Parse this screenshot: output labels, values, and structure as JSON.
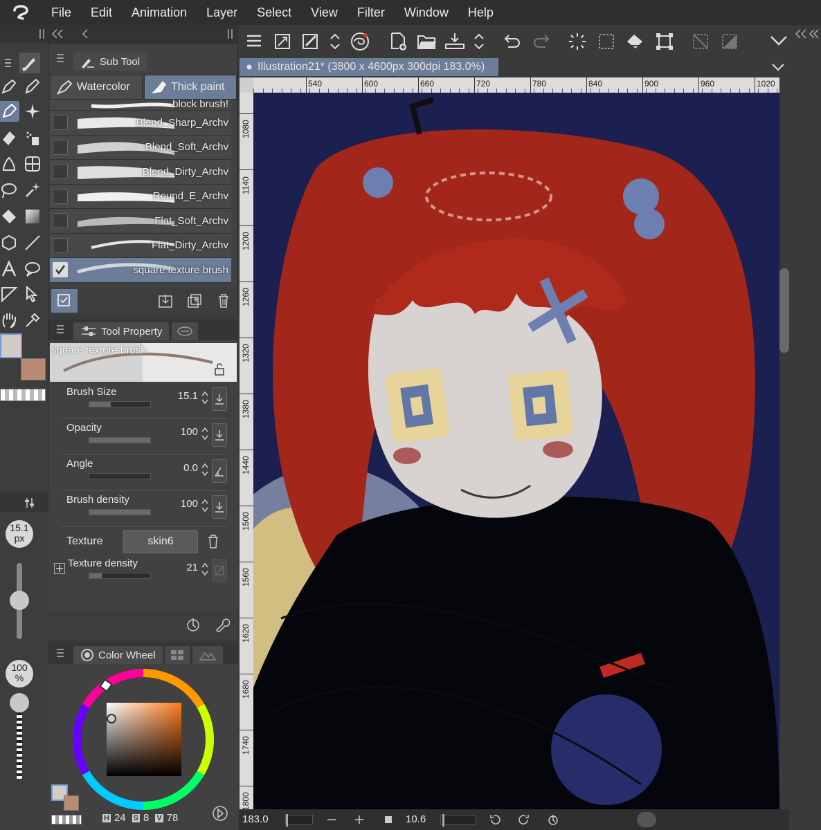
{
  "menu": {
    "items": [
      "File",
      "Edit",
      "Animation",
      "Layer",
      "Select",
      "View",
      "Filter",
      "Window",
      "Help"
    ]
  },
  "subtool": {
    "panel_title": "Sub Tool",
    "groups": [
      {
        "label": "Watercolor",
        "active": false
      },
      {
        "label": "Thick paint",
        "active": true
      }
    ],
    "brushes": [
      {
        "name": "block brush!",
        "active": false
      },
      {
        "name": "Blend_Sharp_Archv",
        "active": false
      },
      {
        "name": "Blend_Soft_Archv",
        "active": false
      },
      {
        "name": "Blend_Dirty_Archv",
        "active": false
      },
      {
        "name": "Round_E_Archv",
        "active": false
      },
      {
        "name": "Flat_Soft_Archv",
        "active": false
      },
      {
        "name": "Flat_Dirty_Archv",
        "active": false
      },
      {
        "name": "square texture brush",
        "active": true
      }
    ]
  },
  "toolprop": {
    "panel_title": "Tool Property",
    "preview_name": "square texture brush",
    "props": [
      {
        "label": "Brush Size",
        "value": "15.1",
        "fill": 0.35
      },
      {
        "label": "Opacity",
        "value": "100",
        "fill": 1.0
      },
      {
        "label": "Angle",
        "value": "0.0",
        "fill": 0.0
      },
      {
        "label": "Brush density",
        "value": "100",
        "fill": 1.0
      }
    ],
    "texture_label": "Texture",
    "texture_value": "skin6",
    "texture_density_label": "Texture density",
    "texture_density_value": "21",
    "texture_density_fill": 0.21
  },
  "leftmini": {
    "size_value": "15.1",
    "size_unit": "px",
    "opacity_value": "100",
    "opacity_unit": "%"
  },
  "colorwheel": {
    "panel_title": "Color Wheel",
    "h_label": "H",
    "h_value": "24",
    "s_label": "S",
    "s_value": "8",
    "v_label": "V",
    "v_value": "78"
  },
  "document": {
    "tab_label": "Illustration21* (3800 x 4600px 300dpi 183.0%)"
  },
  "ruler": {
    "top_ticks": [
      "540",
      "600",
      "660",
      "720",
      "780",
      "840",
      "900",
      "960",
      "1020"
    ],
    "left_ticks": [
      "1080",
      "1140",
      "1200",
      "1260",
      "1320",
      "1380",
      "1440",
      "1500",
      "1560",
      "1620",
      "1680",
      "1740",
      "1800"
    ]
  },
  "status": {
    "zoom": "183.0",
    "angle": "10.6"
  },
  "colors": {
    "accent": "#6b7d99",
    "main_color": "#d4cbc6",
    "sub_color": "#b98b74",
    "canvas_bg": "#1c2050",
    "hair": "#b8261a"
  }
}
